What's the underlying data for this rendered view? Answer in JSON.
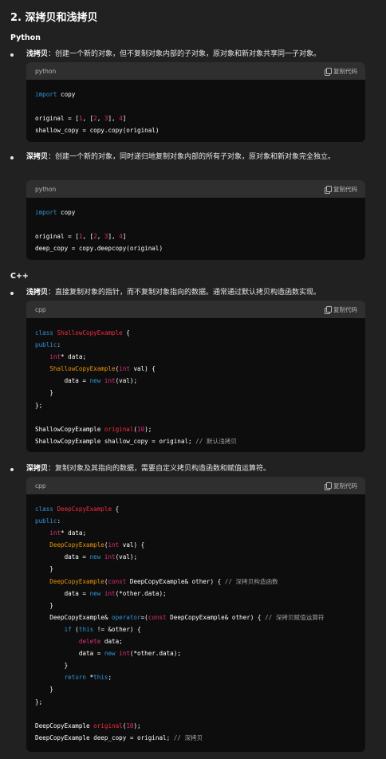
{
  "heading": "2. 深拷贝和浅拷贝",
  "python": {
    "title": "Python",
    "shallow_term": "浅拷贝",
    "shallow_desc": "：创建一个新的对象，但不复制对象内部的子对象，原对象和新对象共享同一子对象。",
    "deep_term": "深拷贝",
    "deep_desc": "：创建一个新的对象，同时递归地复制对象内部的所有子对象，原对象和新对象完全独立。",
    "code_lang": "python"
  },
  "cpp": {
    "title": "C++",
    "shallow_term": "浅拷贝",
    "shallow_desc": "：直接复制对象的指针，而不复制对象指向的数据。通常通过默认拷贝构造函数实现。",
    "deep_term": "深拷贝",
    "deep_desc": "：复制对象及其指向的数据，需要自定义拷贝构造函数和赋值运算符。",
    "code_lang": "cpp"
  },
  "copy_label": "复制代码",
  "code_blocks": {
    "py_shallow": [
      "import copy",
      "",
      "original = [1, [2, 3], 4]",
      "shallow_copy = copy.copy(original)"
    ],
    "py_deep": [
      "import copy",
      "",
      "original = [1, [2, 3], 4]",
      "deep_copy = copy.deepcopy(original)"
    ],
    "cpp_shallow_comment": "// 默认浅拷贝",
    "cpp_deep_ctor_comment": "// 深拷贝构造函数",
    "cpp_deep_assign_comment": "// 深拷贝赋值运算符",
    "cpp_deep_comment": "// 深拷贝"
  }
}
